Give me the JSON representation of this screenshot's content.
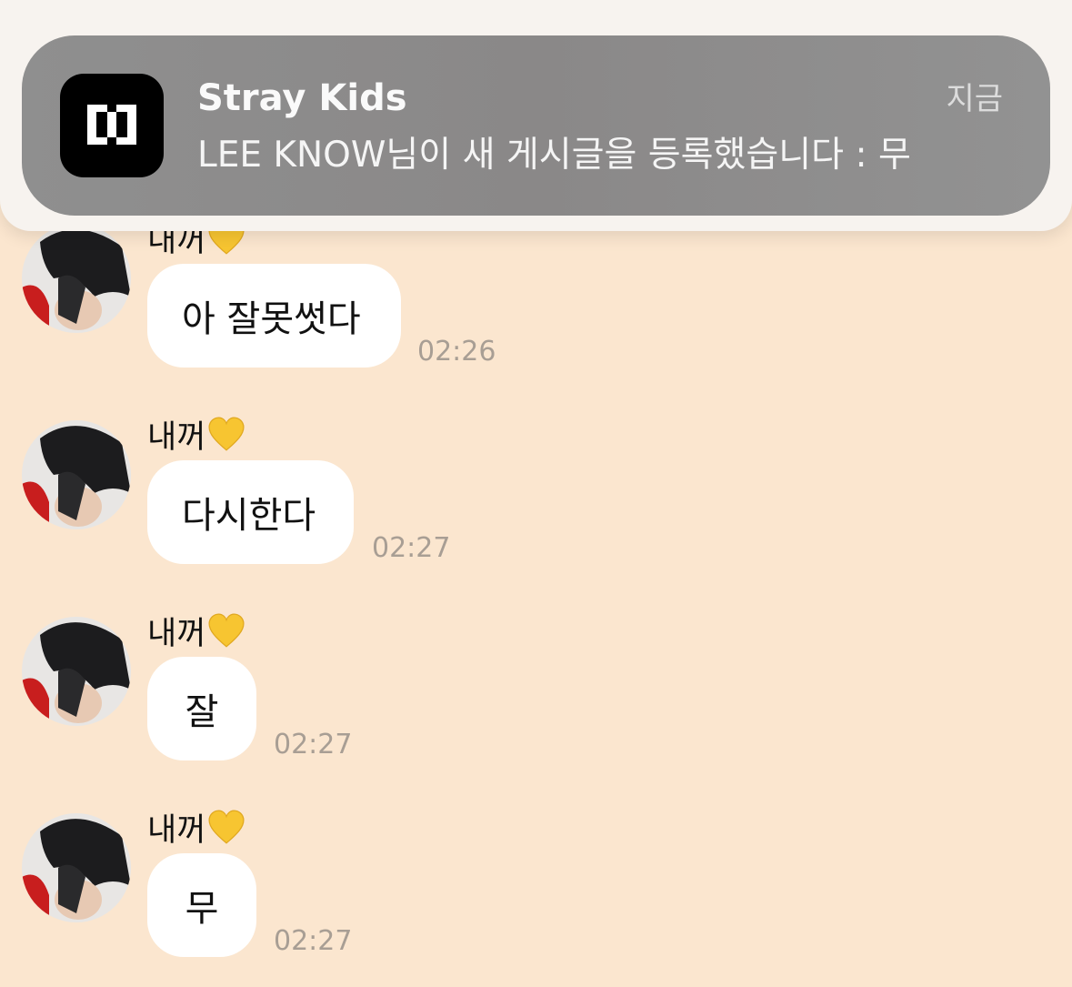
{
  "notification": {
    "app_name": "Stray Kids",
    "time": "지금",
    "body": "LEE KNOW님이 새 게시글을 등록했습니다 : 무",
    "app_icon": "bracket-logo-icon",
    "app_icon_bg": "#000000"
  },
  "chat": {
    "background": "#fbe6cf",
    "bubble_color": "#ffffff",
    "heart_color": "#f7c531",
    "messages": [
      {
        "sender": "내꺼",
        "text": "아 잘못썻다",
        "time": "02:26"
      },
      {
        "sender": "내꺼",
        "text": "다시한다",
        "time": "02:27"
      },
      {
        "sender": "내꺼",
        "text": "잘",
        "time": "02:27"
      },
      {
        "sender": "내꺼",
        "text": "무",
        "time": "02:27"
      }
    ]
  }
}
